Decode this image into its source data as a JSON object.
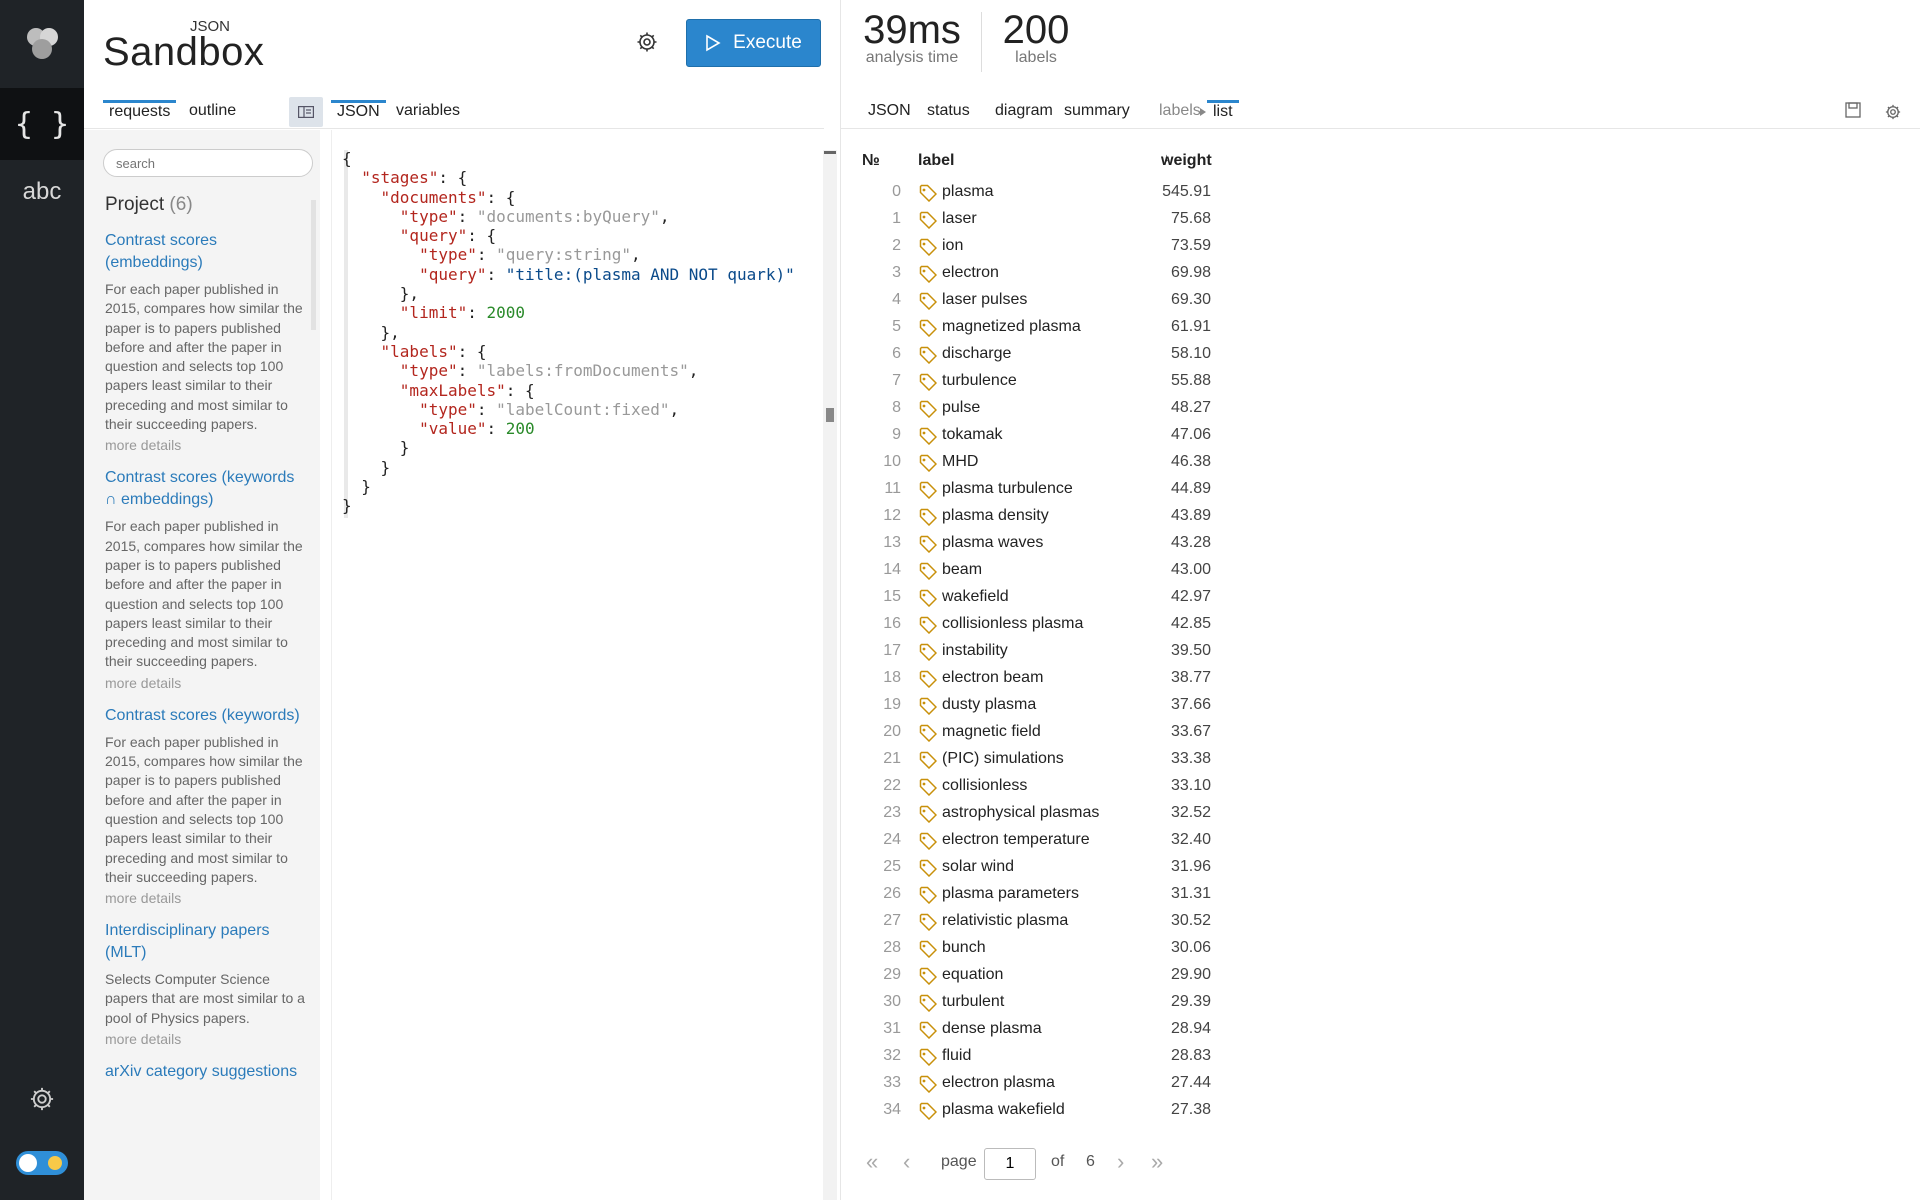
{
  "rail": {
    "json_label": "{ }",
    "abc_label": "abc"
  },
  "brand": {
    "sub": "JSON",
    "main": "Sandbox"
  },
  "toolbar": {
    "execute_label": "Execute"
  },
  "left_tabs": {
    "requests": "requests",
    "outline": "outline",
    "json": "JSON",
    "variables": "variables"
  },
  "search": {
    "placeholder": "search"
  },
  "project": {
    "title": "Project",
    "count": "(6)",
    "items": [
      {
        "title": "Contrast scores (embeddings)",
        "desc": "For each paper published in 2015, compares how similar the paper is to papers published before and after the paper in question and selects top 100 papers least similar to their preceding and most similar to their succeeding papers.",
        "more": "more details"
      },
      {
        "title": "Contrast scores (keywords ∩ embeddings)",
        "desc": "For each paper published in 2015, compares how similar the paper is to papers published before and after the paper in question and selects top 100 papers least similar to their preceding and most similar to their succeeding papers.",
        "more": "more details"
      },
      {
        "title": "Contrast scores (keywords)",
        "desc": "For each paper published in 2015, compares how similar the paper is to papers published before and after the paper in question and selects top 100 papers least similar to their preceding and most similar to their succeeding papers.",
        "more": "more details"
      },
      {
        "title": "Interdisciplinary papers (MLT)",
        "desc": "Selects Computer Science papers that are most similar to a pool of Physics papers.",
        "more": "more details"
      },
      {
        "title": "arXiv category suggestions",
        "desc": "",
        "more": ""
      }
    ]
  },
  "editor": {
    "lines": [
      [
        [
          "p",
          "{"
        ]
      ],
      [
        [
          "p",
          "  "
        ],
        [
          "k",
          "\"stages\""
        ],
        [
          "p",
          ": {"
        ]
      ],
      [
        [
          "p",
          "    "
        ],
        [
          "k",
          "\"documents\""
        ],
        [
          "p",
          ": {"
        ]
      ],
      [
        [
          "p",
          "      "
        ],
        [
          "k",
          "\"type\""
        ],
        [
          "p",
          ": "
        ],
        [
          "s",
          "\"documents:byQuery\""
        ],
        [
          "p",
          ","
        ]
      ],
      [
        [
          "p",
          "      "
        ],
        [
          "k",
          "\"query\""
        ],
        [
          "p",
          ": {"
        ]
      ],
      [
        [
          "p",
          "        "
        ],
        [
          "k",
          "\"type\""
        ],
        [
          "p",
          ": "
        ],
        [
          "s",
          "\"query:string\""
        ],
        [
          "p",
          ","
        ]
      ],
      [
        [
          "p",
          "        "
        ],
        [
          "k",
          "\"query\""
        ],
        [
          "p",
          ": "
        ],
        [
          "q",
          "\"title:(plasma AND NOT quark)\""
        ]
      ],
      [
        [
          "p",
          "      },"
        ]
      ],
      [
        [
          "p",
          "      "
        ],
        [
          "k",
          "\"limit\""
        ],
        [
          "p",
          ": "
        ],
        [
          "n",
          "2000"
        ]
      ],
      [
        [
          "p",
          "    },"
        ]
      ],
      [
        [
          "p",
          "    "
        ],
        [
          "k",
          "\"labels\""
        ],
        [
          "p",
          ": {"
        ]
      ],
      [
        [
          "p",
          "      "
        ],
        [
          "k",
          "\"type\""
        ],
        [
          "p",
          ": "
        ],
        [
          "s",
          "\"labels:fromDocuments\""
        ],
        [
          "p",
          ","
        ]
      ],
      [
        [
          "p",
          "      "
        ],
        [
          "k",
          "\"maxLabels\""
        ],
        [
          "p",
          ": {"
        ]
      ],
      [
        [
          "p",
          "        "
        ],
        [
          "k",
          "\"type\""
        ],
        [
          "p",
          ": "
        ],
        [
          "s",
          "\"labelCount:fixed\""
        ],
        [
          "p",
          ","
        ]
      ],
      [
        [
          "p",
          "        "
        ],
        [
          "k",
          "\"value\""
        ],
        [
          "p",
          ": "
        ],
        [
          "n",
          "200"
        ]
      ],
      [
        [
          "p",
          "      }"
        ]
      ],
      [
        [
          "p",
          "    }"
        ]
      ],
      [
        [
          "p",
          "  }"
        ]
      ],
      [
        [
          "p",
          "}"
        ]
      ]
    ]
  },
  "stats": {
    "time_value": "39ms",
    "time_caption": "analysis time",
    "labels_value": "200",
    "labels_caption": "labels"
  },
  "right_tabs": {
    "json": "JSON",
    "status": "status",
    "diagram": "diagram",
    "summary": "summary",
    "labels": "labels",
    "list": "list"
  },
  "table": {
    "col_no": "№",
    "col_label": "label",
    "col_weight": "weight",
    "rows": [
      [
        "0",
        "plasma",
        "545.91"
      ],
      [
        "1",
        "laser",
        "75.68"
      ],
      [
        "2",
        "ion",
        "73.59"
      ],
      [
        "3",
        "electron",
        "69.98"
      ],
      [
        "4",
        "laser pulses",
        "69.30"
      ],
      [
        "5",
        "magnetized plasma",
        "61.91"
      ],
      [
        "6",
        "discharge",
        "58.10"
      ],
      [
        "7",
        "turbulence",
        "55.88"
      ],
      [
        "8",
        "pulse",
        "48.27"
      ],
      [
        "9",
        "tokamak",
        "47.06"
      ],
      [
        "10",
        "MHD",
        "46.38"
      ],
      [
        "11",
        "plasma turbulence",
        "44.89"
      ],
      [
        "12",
        "plasma density",
        "43.89"
      ],
      [
        "13",
        "plasma waves",
        "43.28"
      ],
      [
        "14",
        "beam",
        "43.00"
      ],
      [
        "15",
        "wakefield",
        "42.97"
      ],
      [
        "16",
        "collisionless plasma",
        "42.85"
      ],
      [
        "17",
        "instability",
        "39.50"
      ],
      [
        "18",
        "electron beam",
        "38.77"
      ],
      [
        "19",
        "dusty plasma",
        "37.66"
      ],
      [
        "20",
        "magnetic field",
        "33.67"
      ],
      [
        "21",
        "(PIC) simulations",
        "33.38"
      ],
      [
        "22",
        "collisionless",
        "33.10"
      ],
      [
        "23",
        "astrophysical plasmas",
        "32.52"
      ],
      [
        "24",
        "electron temperature",
        "32.40"
      ],
      [
        "25",
        "solar wind",
        "31.96"
      ],
      [
        "26",
        "plasma parameters",
        "31.31"
      ],
      [
        "27",
        "relativistic plasma",
        "30.52"
      ],
      [
        "28",
        "bunch",
        "30.06"
      ],
      [
        "29",
        "equation",
        "29.90"
      ],
      [
        "30",
        "turbulent",
        "29.39"
      ],
      [
        "31",
        "dense plasma",
        "28.94"
      ],
      [
        "32",
        "fluid",
        "28.83"
      ],
      [
        "33",
        "electron plasma",
        "27.44"
      ],
      [
        "34",
        "plasma wakefield",
        "27.38"
      ]
    ]
  },
  "pager": {
    "page_label": "page",
    "current": "1",
    "of_label": "of",
    "total": "6"
  },
  "colors": {
    "accent": "#2b86cd",
    "rail": "#1f2327",
    "tag": "#c8900a"
  }
}
